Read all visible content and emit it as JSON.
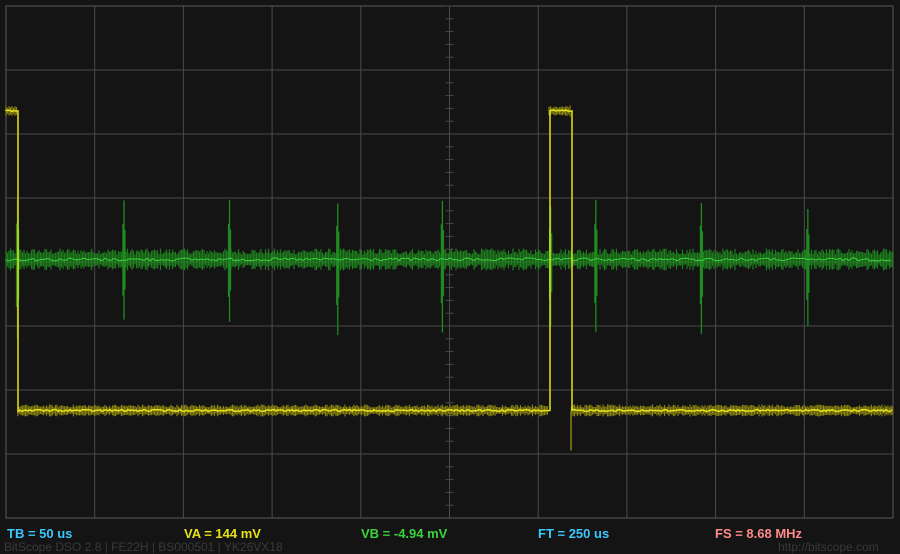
{
  "colors": {
    "background": "#141414",
    "grid": "#4a4a4a",
    "border": "#5a5a5a",
    "channel_a": "#e8e21a",
    "channel_a_noise": "#8a8410",
    "channel_b": "#3cd23c",
    "channel_b_noise": "#1f8a1f",
    "tb": "#3cc8ff",
    "va": "#e8e21a",
    "vb": "#3cd23c",
    "ft": "#3cc8ff",
    "fs": "#ff8a8a"
  },
  "readouts": {
    "tb": "TB = 50 us",
    "va": "VA = 144 mV",
    "vb": "VB = -4.94 mV",
    "ft": "FT = 250 us",
    "fs": "FS = 8.68 MHz"
  },
  "footer": {
    "left": "BitScope DSO 2.8 | FE22H | BS000501 | YK26VX18",
    "right": "http://bitscope.com"
  },
  "chart_data": {
    "type": "line",
    "grid": true,
    "x_divisions": 10,
    "y_divisions": 8,
    "series": [
      {
        "channel": "A",
        "kind": "pulse",
        "low_level_div": 1.68,
        "high_level_div": 6.36,
        "pulses_div": [
          [
            -0.08,
            0.13
          ],
          [
            6.12,
            6.37
          ]
        ]
      },
      {
        "channel": "B",
        "kind": "noise",
        "level_div": 4.04,
        "spike_times_div": [
          0.13,
          1.33,
          2.52,
          3.74,
          4.92,
          6.14,
          6.65,
          7.84,
          9.04
        ]
      }
    ]
  }
}
